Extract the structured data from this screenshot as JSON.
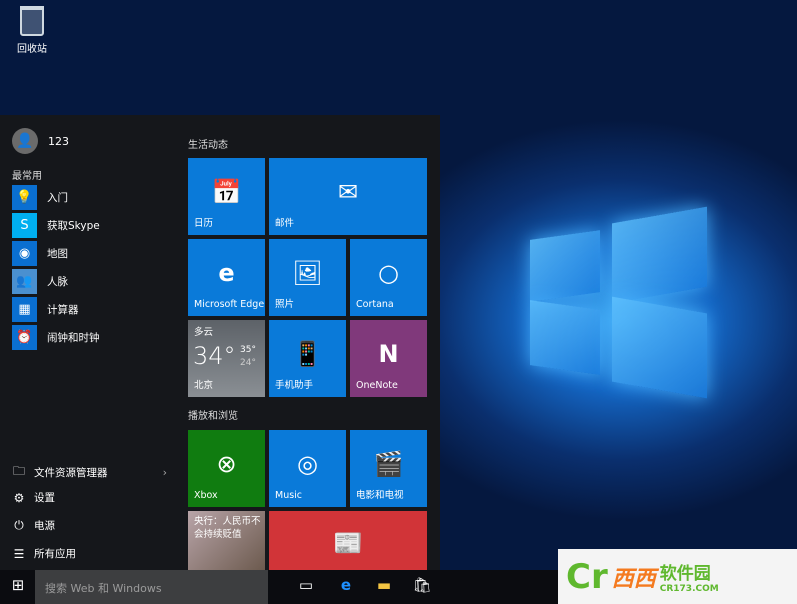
{
  "desktop": {
    "recycle_bin_label": "回收站"
  },
  "start_menu": {
    "user_name": "123",
    "most_used_label": "最常用",
    "apps": [
      {
        "label": "入门",
        "icon": "lightbulb-icon"
      },
      {
        "label": "获取Skype",
        "icon": "skype-icon"
      },
      {
        "label": "地图",
        "icon": "map-icon"
      },
      {
        "label": "人脉",
        "icon": "people-icon"
      },
      {
        "label": "计算器",
        "icon": "calculator-icon"
      },
      {
        "label": "闹钟和时钟",
        "icon": "alarm-icon"
      }
    ],
    "system": [
      {
        "label": "文件资源管理器",
        "icon": "folder-icon"
      },
      {
        "label": "设置",
        "icon": "gear-icon"
      },
      {
        "label": "电源",
        "icon": "power-icon"
      },
      {
        "label": "所有应用",
        "icon": "list-icon"
      }
    ],
    "group1_label": "生活动态",
    "group2_label": "播放和浏览",
    "tiles": {
      "calendar": "日历",
      "mail": "邮件",
      "edge": "Microsoft Edge",
      "photos": "照片",
      "cortana": "Cortana",
      "phone": "手机助手",
      "onenote": "OneNote",
      "xbox": "Xbox",
      "music": "Music",
      "movies": "电影和电视",
      "news": "央行：人民币不会持续贬值"
    },
    "weather": {
      "condition": "多云",
      "temp": "34°",
      "high": "35°",
      "low": "24°",
      "city": "北京"
    }
  },
  "taskbar": {
    "search_placeholder": "搜索 Web 和 Windows"
  },
  "watermark": {
    "brand": "西西软件园",
    "site": "CR173.COM"
  },
  "colors": {
    "tile_blue": "#0a7ad9",
    "xbox_green": "#107c10",
    "onenote_purple": "#80397b",
    "news_red": "#d13438"
  }
}
